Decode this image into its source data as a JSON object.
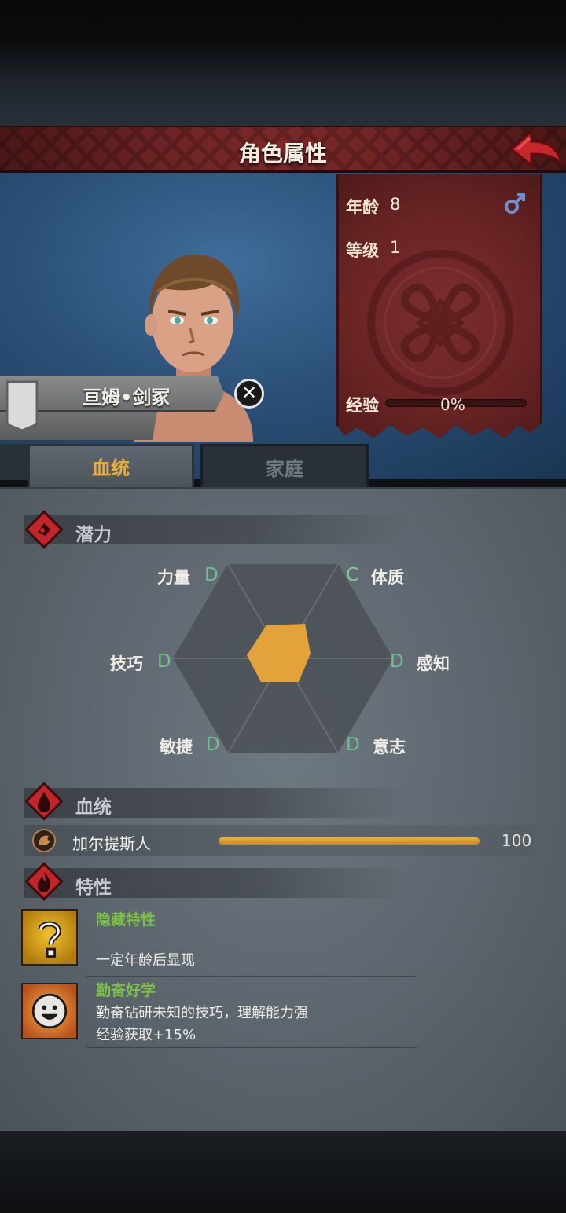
{
  "header": {
    "title": "角色属性"
  },
  "character": {
    "name": "亘姆•剑冢",
    "age_label": "年龄",
    "age": "8",
    "level_label": "等级",
    "level": "1",
    "exp_label": "经验",
    "exp_percent_text": "0%",
    "exp_fraction": 0.0,
    "gender_icon": "male-symbol-icon"
  },
  "tabs": [
    {
      "label": "血统",
      "active": true
    },
    {
      "label": "家庭",
      "active": false
    }
  ],
  "potential": {
    "title": "潜力",
    "attributes": [
      {
        "name": "力量",
        "grade": "D"
      },
      {
        "name": "体质",
        "grade": "C"
      },
      {
        "name": "技巧",
        "grade": "D"
      },
      {
        "name": "感知",
        "grade": "D"
      },
      {
        "name": "敏捷",
        "grade": "D"
      },
      {
        "name": "意志",
        "grade": "D"
      }
    ]
  },
  "bloodline": {
    "title": "血统",
    "items": [
      {
        "name": "加尔提斯人",
        "value": "100",
        "fraction": 1.0
      }
    ]
  },
  "traits": {
    "title": "特性",
    "items": [
      {
        "name": "隐藏特性",
        "desc1": "一定年龄后显现",
        "icon": "question-mark-icon"
      },
      {
        "name": "勤奋好学",
        "desc1": "勤奋钻研未知的技巧，理解能力强",
        "desc2": "经验获取+15%",
        "icon": "smiley-face-icon"
      }
    ]
  },
  "colors": {
    "grade_d": "#6fc08a",
    "grade_c": "#7ed08c",
    "active_tab": "#e9ae3a",
    "trait_name": "#7cc04a",
    "radar_fill": "#e3a33a"
  }
}
